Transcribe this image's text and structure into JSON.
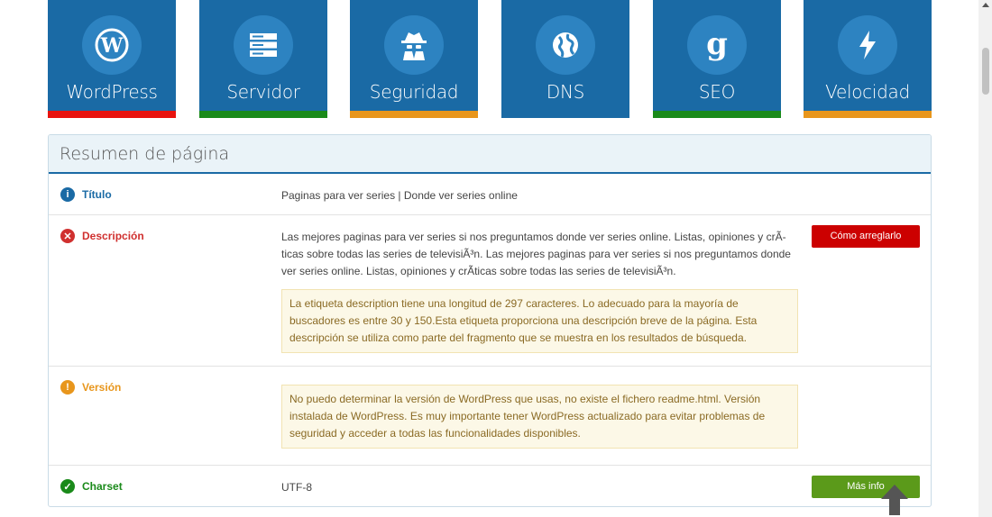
{
  "tiles": [
    {
      "label": "WordPress",
      "icon": "wordpress-icon",
      "bar_color": "#e8130f"
    },
    {
      "label": "Servidor",
      "icon": "server-icon",
      "bar_color": "#1a8a1a"
    },
    {
      "label": "Seguridad",
      "icon": "spy-icon",
      "bar_color": "#e8961c"
    },
    {
      "label": "DNS",
      "icon": "globe-icon",
      "bar_color": "#1a6aa5"
    },
    {
      "label": "SEO",
      "icon": "google-icon",
      "bar_color": "#1a8a1a"
    },
    {
      "label": "Velocidad",
      "icon": "bolt-icon",
      "bar_color": "#e8961c"
    }
  ],
  "panel": {
    "title": "Resumen de página",
    "rows": [
      {
        "label": "Título",
        "status": "info",
        "value": "Paginas para ver series | Donde ver series online"
      },
      {
        "label": "Descripción",
        "status": "error",
        "value": "Las mejores paginas para ver series si nos preguntamos donde ver series online. Listas, opiniones y crÃ-ticas sobre todas las series de televisiÃ³n. Las mejores paginas para ver series si nos preguntamos donde ver series online. Listas, opiniones y crÃticas sobre todas las series de televisiÃ³n.",
        "note": "La etiqueta description tiene una longitud de 297 caracteres. Lo adecuado para la mayoría de buscadores es entre 30 y 150.Esta etiqueta proporciona una descripción breve de la página. Esta descripción se utiliza como parte del fragmento que se muestra en los resultados de búsqueda.",
        "button": "Cómo arreglarlo"
      },
      {
        "label": "Versión",
        "status": "warning",
        "note": "No puedo determinar la versión de WordPress que usas, no existe el fichero readme.html. Versión instalada de WordPress. Es muy importante tener WordPress actualizado para evitar problemas de seguridad y acceder a todas las funcionalidades disponibles."
      },
      {
        "label": "Charset",
        "status": "ok",
        "value": "UTF-8",
        "button": "Más info"
      }
    ]
  },
  "colors": {
    "info": "#1a6aa5",
    "error": "#d0302f",
    "warning": "#e8961c",
    "ok": "#1a8a1a",
    "btn_red": "#cc0000",
    "btn_green": "#5b9a1a"
  }
}
